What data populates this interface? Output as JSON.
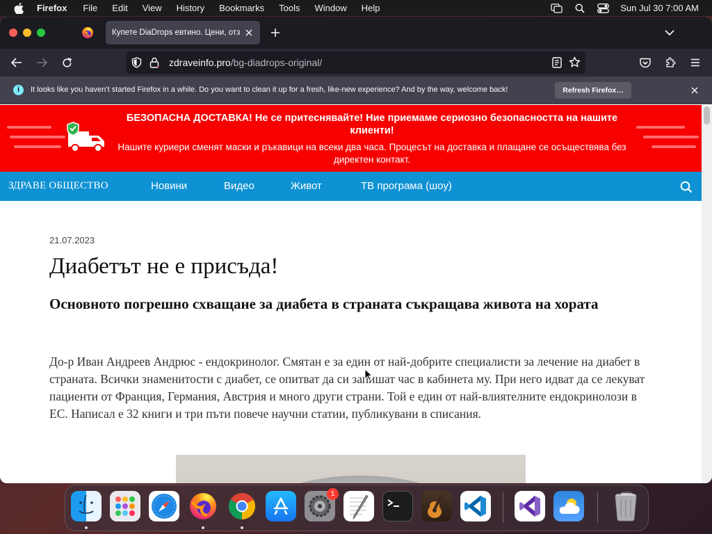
{
  "menubar": {
    "app_name": "Firefox",
    "items": [
      "File",
      "Edit",
      "View",
      "History",
      "Bookmarks",
      "Tools",
      "Window",
      "Help"
    ],
    "clock": "Sun Jul 30  7:00 AM"
  },
  "browser": {
    "tab_title": "Купете DiaDrops евтино. Цени, отзиви",
    "url_domain": "zdraveinfo.pro",
    "url_path": "/bg-diadrops-original/",
    "notice_text": "It looks like you haven’t started Firefox in a while. Do you want to clean it up for a fresh, like-new experience? And by the way, welcome back!",
    "notice_button": "Refresh Firefox…",
    "info_glyph": "i"
  },
  "promo": {
    "headline": "БЕЗОПАСНА ДОСТАВКА! Не се притеснявайте! Ние приемаме сериозно безопасността на нашите клиенти!",
    "subtext": "Нашите куриери сменят маски и ръкавици на всеки два часа. Процесът на доставка и плащане се осъществява без директен контакт.",
    "colors": {
      "background": "#f70000",
      "stripe": "#ff6b6b"
    }
  },
  "site_nav": {
    "logo": "ЗДРАВЕ ОБЩЕСТВО",
    "links": [
      "Новини",
      "Видео",
      "Живот",
      "ТВ програма (шоу)"
    ],
    "colors": {
      "background": "#0e92d3"
    }
  },
  "article": {
    "date": "21.07.2023",
    "title": "Диабетът не е присъда!",
    "subtitle": "Основното погрешно схващане за диабета в страната съкращава живота на хората",
    "body": "До-р Иван Андреев Андрюс - ендокринолог. Смятан е за един от най-добрите специалисти за лечение на диабет в страната. Всички знаменитости с диабет, се опитват да си запишат час в кабинета му. При него идват да се лекуват пациенти от Франция, Германия, Австрия и много други страни. Той е един от най-влиятелните ендокринолози в ЕС. Написал е 32 книги и три пъти повече научни статии, публикувани в списания."
  },
  "dock": {
    "apps": [
      "finder-icon",
      "launchpad-icon",
      "safari-icon",
      "firefox-icon",
      "chrome-icon",
      "app-store-icon",
      "system-settings-icon",
      "textedit-icon",
      "terminal-icon",
      "garageband-icon",
      "vscode-icon",
      "visual-studio-icon",
      "weather-icon",
      "trash-icon"
    ],
    "settings_badge": "1"
  }
}
